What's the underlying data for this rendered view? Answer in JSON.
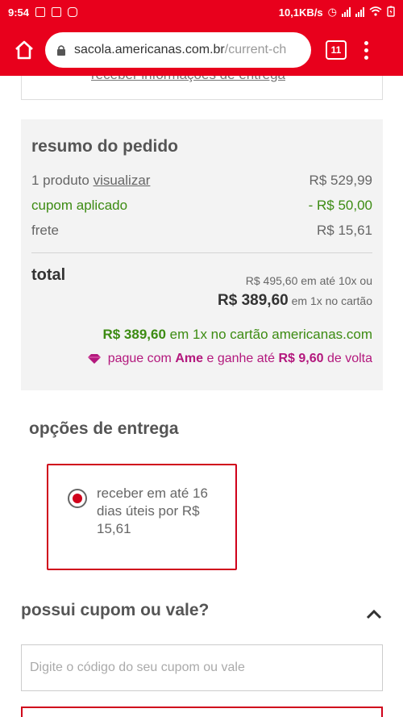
{
  "status_bar": {
    "time": "9:54",
    "speed": "10,1KB/s"
  },
  "browser": {
    "url_host": "sacola.americanas.com.br",
    "url_path": "/current-ch",
    "tab_count": "11"
  },
  "top_link": "receber informações de entrega",
  "summary": {
    "title": "resumo do pedido",
    "products_prefix": "1 produto",
    "products_link": "visualizar",
    "products_value": "R$ 529,99",
    "coupon_label": "cupom aplicado",
    "coupon_value": "- R$ 50,00",
    "shipping_label": "frete",
    "shipping_value": "R$ 15,61",
    "total_label": "total",
    "installments": "R$ 495,60 em até 10x ou",
    "cash_price": "R$ 389,60",
    "cash_suffix": "em 1x no cartão",
    "card_price": "R$ 389,60",
    "card_suffix": "em 1x no cartão americanas.com",
    "ame_prefix": "pague com",
    "ame_brand": "Ame",
    "ame_middle": "e ganhe até",
    "ame_value": "R$ 9,60",
    "ame_suffix": "de volta"
  },
  "delivery": {
    "title": "opções de entrega",
    "option_text": "receber em até 16 dias úteis por R$ 15,61",
    "selected": true
  },
  "coupon": {
    "title": "possui cupom ou vale?",
    "placeholder": "Digite o código do seu cupom ou vale",
    "value": ""
  },
  "colors": {
    "brand_red": "#e8001c",
    "green": "#3c8b12",
    "ame_pink": "#b3187d"
  },
  "icons": [
    "home-icon",
    "lock-icon",
    "tabs-icon",
    "menu-icon",
    "radio-selected-icon",
    "diamond-icon",
    "chevron-up-icon"
  ]
}
